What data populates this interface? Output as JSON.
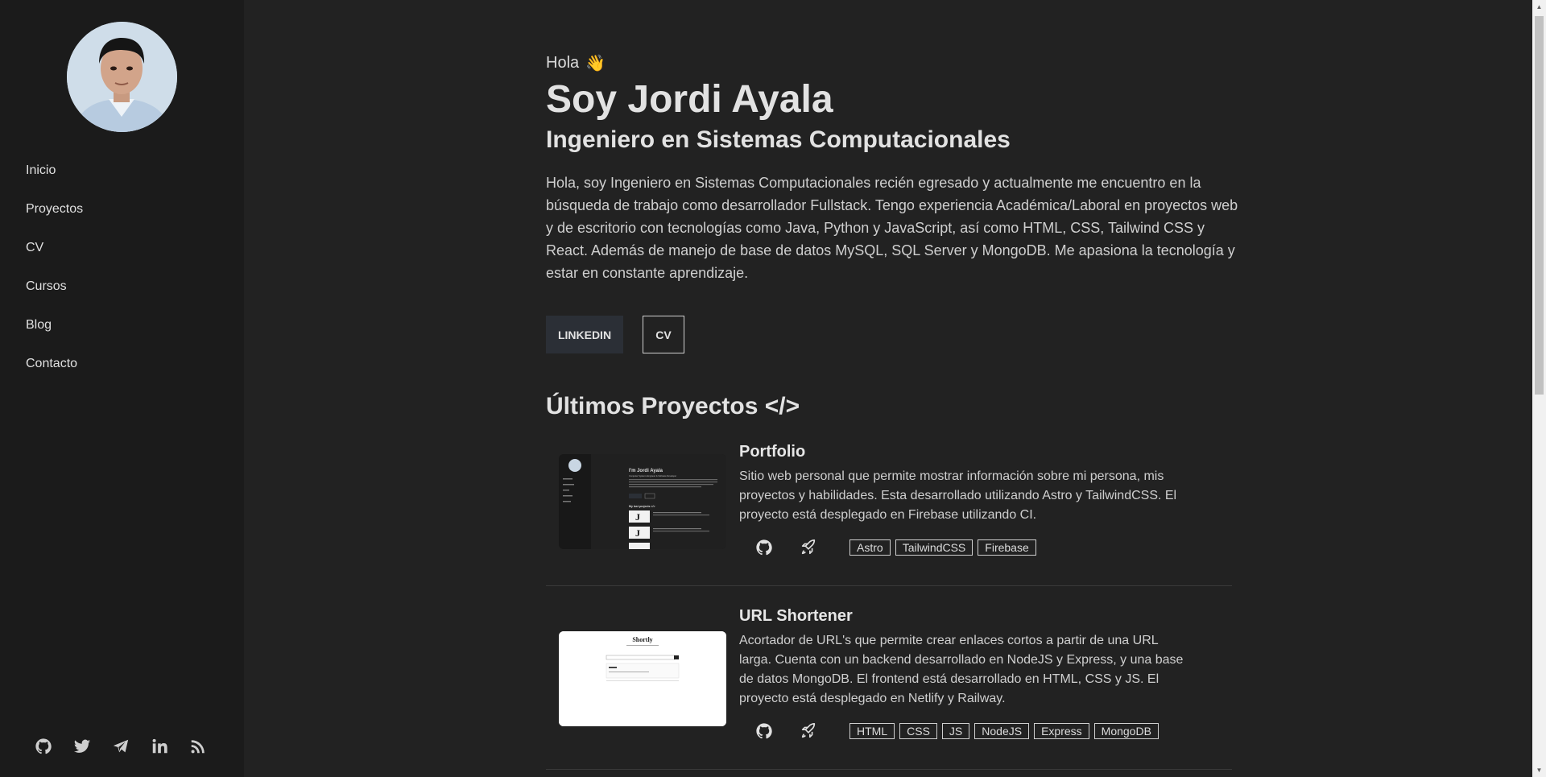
{
  "sidebar": {
    "nav": [
      "Inicio",
      "Proyectos",
      "CV",
      "Cursos",
      "Blog",
      "Contacto"
    ],
    "socials": [
      "github-icon",
      "twitter-icon",
      "telegram-icon",
      "linkedin-icon",
      "rss-icon"
    ]
  },
  "hero": {
    "greeting": "Hola",
    "greeting_emoji": "👋",
    "name": "Soy Jordi Ayala",
    "role": "Ingeniero en Sistemas Computacionales",
    "bio": "Hola, soy Ingeniero en Sistemas Computacionales recién egresado y actualmente me encuentro en la búsqueda de trabajo como desarrollador Fullstack. Tengo experiencia Académica/Laboral en proyectos web y de escritorio con tecnologías como Java, Python y JavaScript, así como HTML, CSS, Tailwind CSS y React. Además de manejo de base de datos MySQL, SQL Server y MongoDB. Me apasiona la tecnología y estar en constante aprendizaje.",
    "linkedin_label": "LINKEDIN",
    "cv_label": "CV"
  },
  "projects_section": {
    "title": "Últimos Proyectos </>",
    "projects": [
      {
        "title": "Portfolio",
        "description": "Sitio web personal que permite mostrar información sobre mi persona, mis proyectos y habilidades. Esta desarrollado utilizando Astro y TailwindCSS. El proyecto está desplegado en Firebase utilizando CI.",
        "tags": [
          "Astro",
          "TailwindCSS",
          "Firebase"
        ],
        "thumb_text": [
          "I'm Jordi Ayala",
          "Computer Systems Engineer & Software Developer",
          "My last projects </>"
        ]
      },
      {
        "title": "URL Shortener",
        "description": "Acortador de URL's que permite crear enlaces cortos a partir de una URL larga. Cuenta con un backend desarrollado en NodeJS y Express, y una base de datos MongoDB. El frontend está desarrollado en HTML, CSS y JS. El proyecto está desplegado en Netlify y Railway.",
        "tags": [
          "HTML",
          "CSS",
          "JS",
          "NodeJS",
          "Express",
          "MongoDB"
        ],
        "thumb_text": [
          "Shortly"
        ]
      }
    ]
  },
  "colors": {
    "background": "#222222",
    "sidebar": "#1b1b1b",
    "text": "#d4d4d4",
    "button_bg": "#2b2f36"
  }
}
